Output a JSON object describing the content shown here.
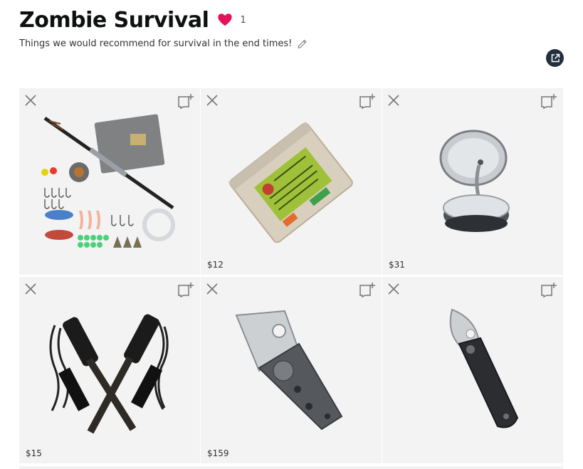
{
  "list": {
    "title": "Zombie Survival",
    "like_count": "1",
    "description": "Things we would recommend for survival in the end times!"
  },
  "colors": {
    "heart": "#e3125b",
    "share_button": "#232f3e",
    "tile_background": "#f3f3f3"
  },
  "icons": {
    "heart": "heart-icon",
    "edit": "pencil-icon",
    "share": "share-icon",
    "remove": "close-icon",
    "add_to_list": "add-to-list-icon"
  },
  "items": [
    {
      "image": "fishing-rod-kit",
      "price": ""
    },
    {
      "image": "survival-fishing-kit-pouch",
      "price": "$12"
    },
    {
      "image": "pocket-solar-still-tin",
      "price": "$31"
    },
    {
      "image": "ferro-rod-fire-starters",
      "price": "$15"
    },
    {
      "image": "folding-cleaver-knife",
      "price": "$159"
    },
    {
      "image": "folding-pocket-knife",
      "price": ""
    }
  ]
}
